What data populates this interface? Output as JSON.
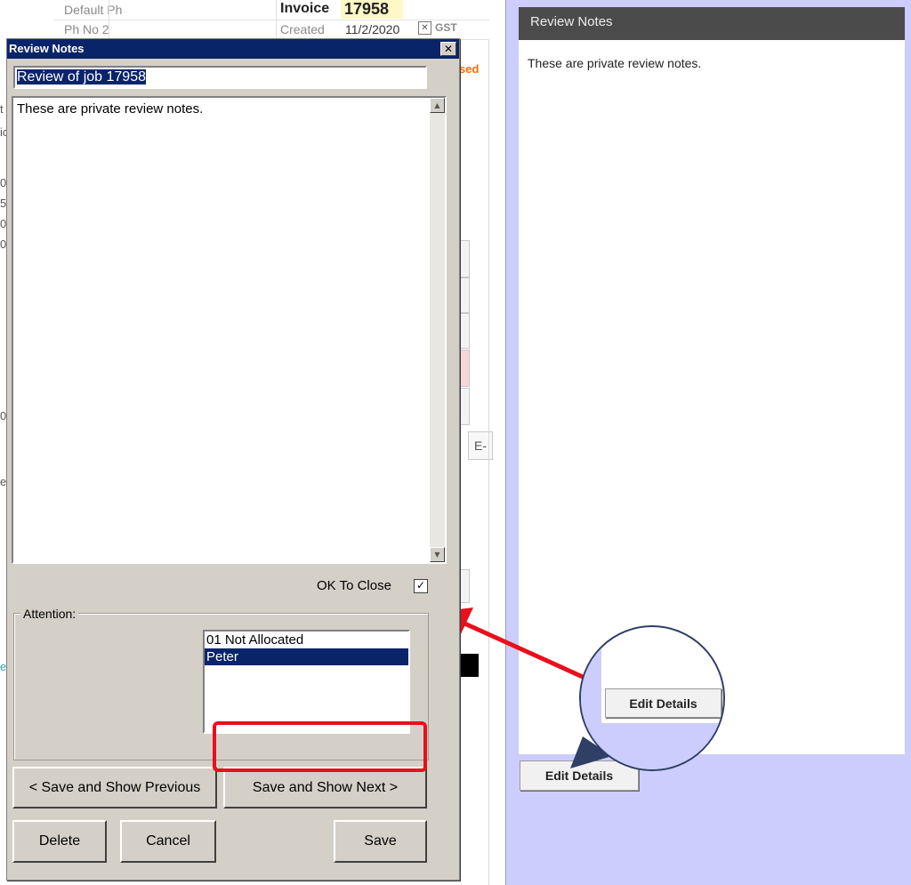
{
  "background_app": {
    "default_ph_label": "Default Ph",
    "ph_no_2_label": "Ph No 2",
    "invoice_label": "Invoice",
    "invoice_number": "17958",
    "created_label": "Created",
    "created_date": "11/2/2020",
    "gst_label": "GST",
    "used_fragment": "sed",
    "e_button": "E-",
    "fragments": [
      "t",
      "ic",
      "0",
      "5",
      "0",
      "0",
      "0",
      "e",
      "e"
    ]
  },
  "right_panel": {
    "header_title": "Review Notes",
    "notes_text": "These are private review notes.",
    "edit_details_label": "Edit Details"
  },
  "callout": {
    "edit_details_label": "Edit Details"
  },
  "dialog": {
    "title": "Review Notes",
    "close_glyph": "✕",
    "subject_value": "Review of job 17958",
    "notes_text": "These are private review notes.",
    "scroll_up_glyph": "▲",
    "scroll_down_glyph": "▼",
    "ok_to_close_label": "OK To Close",
    "ok_to_close_checked": "✓",
    "attention_label": "Attention:",
    "attention_options": [
      {
        "label": "01 Not Allocated",
        "selected": false
      },
      {
        "label": "Peter",
        "selected": true
      }
    ],
    "save_previous_label": "< Save and Show Previous",
    "save_next_label": "Save and Show Next >",
    "delete_label": "Delete",
    "cancel_label": "Cancel",
    "save_label": "Save"
  },
  "colors": {
    "dialog_face": "#d4d0c8",
    "titlebar": "#0a246a",
    "panel_background": "#cccdfc",
    "panel_header": "#4b4b4b",
    "highlight_red": "#e8101a",
    "invoice_highlight": "#fff8c6",
    "used_orange": "#ff6a00"
  }
}
